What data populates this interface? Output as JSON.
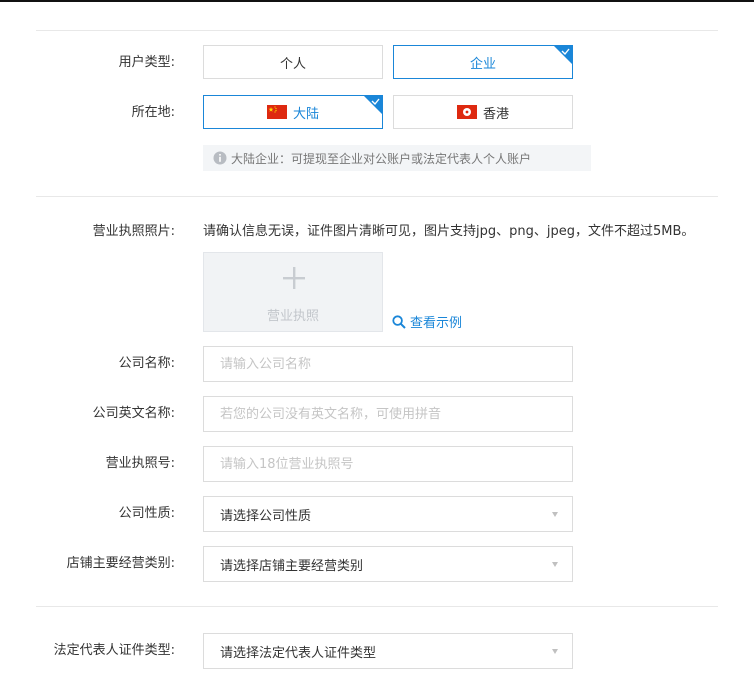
{
  "user_type": {
    "label": "用户类型:",
    "options": [
      "个人",
      "企业"
    ],
    "selected": "企业"
  },
  "location": {
    "label": "所在地:",
    "options": [
      "大陆",
      "香港"
    ],
    "selected": "大陆"
  },
  "hint": "大陆企业：可提现至企业对公账户或法定代表人个人账户",
  "license_photo": {
    "label": "营业执照照片:",
    "note": "请确认信息无误，证件图片清晰可见，图片支持jpg、png、jpeg，文件不超过5MB。",
    "upload_text": "营业执照",
    "example_link": "查看示例"
  },
  "company_name": {
    "label": "公司名称:",
    "placeholder": "请输入公司名称"
  },
  "company_english_name": {
    "label": "公司英文名称:",
    "placeholder": "若您的公司没有英文名称，可使用拼音"
  },
  "license_number": {
    "label": "营业执照号:",
    "placeholder": "请输入18位营业执照号"
  },
  "company_nature": {
    "label": "公司性质:",
    "value": "请选择公司性质"
  },
  "store_category": {
    "label": "店铺主要经营类别:",
    "value": "请选择店铺主要经营类别"
  },
  "legal_rep_id_type": {
    "label": "法定代表人证件类型:",
    "value": "请选择法定代表人证件类型"
  },
  "colors": {
    "accent": "#1a86d8",
    "border": "#dcdcdc",
    "hint_bg": "#f3f5f7"
  },
  "icons": [
    "check-corner-icon",
    "china-flag-icon",
    "hong-kong-flag-icon",
    "info-icon",
    "plus-icon",
    "search-icon",
    "chevron-down-icon"
  ]
}
